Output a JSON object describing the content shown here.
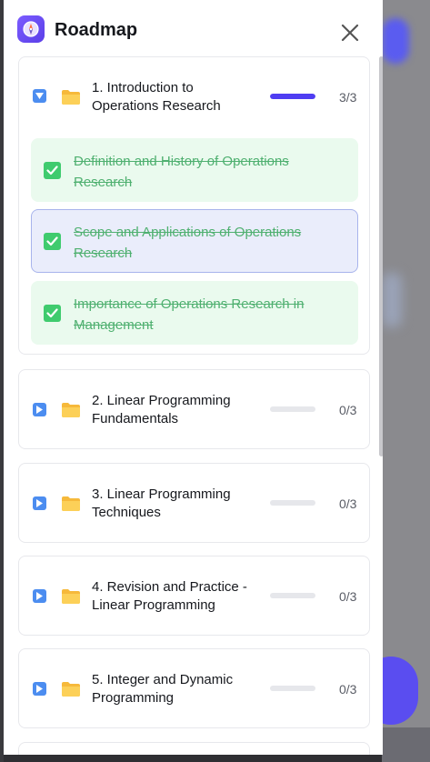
{
  "header": {
    "title": "Roadmap"
  },
  "modules": [
    {
      "title": "1. Introduction to Operations Research",
      "progress": 1.0,
      "count": "3/3",
      "expanded": true,
      "lessons": [
        {
          "title": "Definition and History of Operations Research",
          "completed": true,
          "active": false
        },
        {
          "title": "Scope and Applications of Operations Research",
          "completed": true,
          "active": true
        },
        {
          "title": "Importance of Operations Research in Management",
          "completed": true,
          "active": false
        }
      ]
    },
    {
      "title": "2. Linear Programming Fundamentals",
      "progress": 0,
      "count": "0/3",
      "expanded": false
    },
    {
      "title": "3. Linear Programming Techniques",
      "progress": 0,
      "count": "0/3",
      "expanded": false
    },
    {
      "title": "4. Revision and Practice - Linear Programming",
      "progress": 0,
      "count": "0/3",
      "expanded": false
    },
    {
      "title": "5. Integer and Dynamic Programming",
      "progress": 0,
      "count": "0/3",
      "expanded": false
    }
  ],
  "colors": {
    "accent": "#4f3df2",
    "toggle": "#4c8df0",
    "completed_text": "#4fb070",
    "completed_bg": "#eafaee",
    "active_bg": "#eaedfb",
    "check": "#3fcb6e"
  },
  "icons": {
    "app": "compass-icon",
    "close": "close-icon",
    "expanded_toggle": "caret-down-icon",
    "collapsed_toggle": "caret-right-icon",
    "folder": "folder-icon",
    "lesson_done": "checkbox-checked-icon"
  }
}
